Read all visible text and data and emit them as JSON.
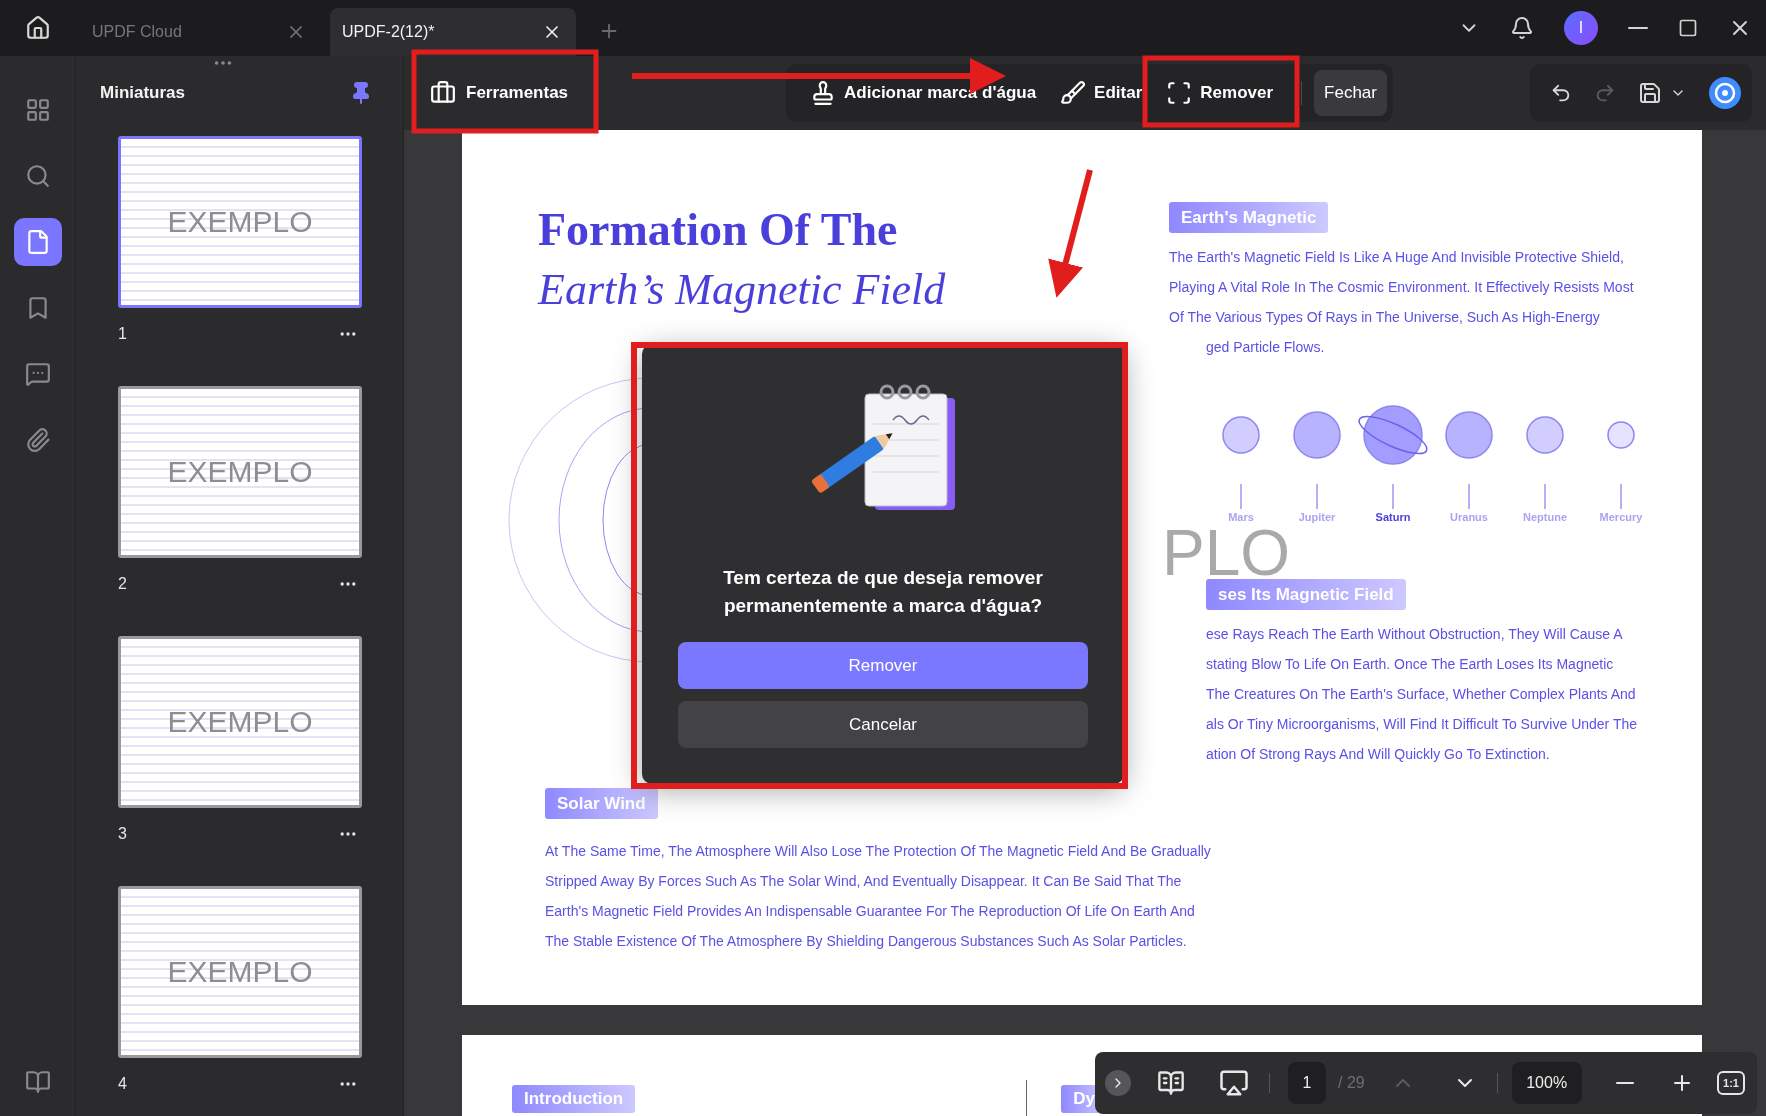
{
  "tabs": [
    {
      "label": "UPDF Cloud",
      "selected": false
    },
    {
      "label": "UPDF-2(12)*",
      "selected": true
    }
  ],
  "account": {
    "initial": "I"
  },
  "rail": [
    {
      "kind": "grid",
      "selected": false
    },
    {
      "kind": "search",
      "selected": false
    },
    {
      "kind": "page",
      "selected": true
    },
    {
      "kind": "bookmark",
      "selected": false
    },
    {
      "kind": "comment",
      "selected": false
    },
    {
      "kind": "attachment",
      "selected": false
    },
    {
      "kind": "library",
      "selected": false
    }
  ],
  "thumbnails": {
    "title": "Miniaturas",
    "pages": [
      {
        "number": "1",
        "watermark": "EXEMPLO",
        "selected": true
      },
      {
        "number": "2",
        "watermark": "EXEMPLO",
        "selected": false
      },
      {
        "number": "3",
        "watermark": "EXEMPLO",
        "selected": false
      },
      {
        "number": "4",
        "watermark": "EXEMPLO",
        "selected": false
      }
    ]
  },
  "toolbar": {
    "tools": "Ferramentas",
    "actions": [
      {
        "label": "Adicionar marca d'água",
        "kind": "add"
      },
      {
        "label": "Editar",
        "kind": "edit"
      },
      {
        "label": "Remover",
        "kind": "remove"
      },
      {
        "label": "Fechar",
        "kind": "close"
      }
    ]
  },
  "document": {
    "title": "Formation Of The",
    "subtitle": "Earth’s Magnetic Field",
    "watermark": "PLO",
    "sections": [
      {
        "heading": {
          "text": "Earth's Magnetic",
          "kind": "open"
        },
        "lines": [
          {
            "text": "The Earth's Magnetic Field Is Like A Huge And Invisible Protective Shield,",
            "kind": "open"
          },
          {
            "text": "Playing A Vital Role In The Cosmic Environment. It Effectively Resists Most",
            "kind": "open"
          },
          {
            "text": "Of The Various Types Of Rays in The Universe, Such As High-Energy",
            "kind": "open"
          },
          {
            "text": "ged Particle Flows.",
            "kind": "behind_dialog"
          }
        ]
      },
      {
        "heading": {
          "text": "ses Its Magnetic Field",
          "kind": "behind_dialog"
        },
        "lines": [
          {
            "text": "ese Rays Reach The Earth Without Obstruction, They Will Cause A",
            "kind": "behind_dialog"
          },
          {
            "text": "stating Blow To Life On Earth. Once The Earth Loses Its Magnetic",
            "kind": "behind_dialog"
          },
          {
            "text": "The Creatures On The Earth's Surface, Whether Complex Plants And",
            "kind": "behind_dialog"
          },
          {
            "text": "als Or Tiny Microorganisms, Will Find It Difficult To Survive Under The",
            "kind": "behind_dialog"
          },
          {
            "text": "ation Of Strong Rays And Will Quickly Go To Extinction.",
            "kind": "behind_dialog"
          }
        ]
      }
    ],
    "planets": [
      {
        "name": "Mars",
        "kind": "plain"
      },
      {
        "name": "Jupiter",
        "kind": "plain"
      },
      {
        "name": "Saturn",
        "kind": "ringed"
      },
      {
        "name": "Uranus",
        "kind": "plain"
      },
      {
        "name": "Neptune",
        "kind": "plain"
      },
      {
        "name": "Mercury",
        "kind": "plain"
      }
    ],
    "solar_wind": {
      "heading": "Solar Wind",
      "lines": [
        "At The Same Time, The Atmosphere Will Also Lose The Protection Of The Magnetic Field And Be Gradually",
        "Stripped Away By Forces Such As The Solar Wind, And Eventually Disappear. It Can Be Said That The",
        "Earth's Magnetic Field Provides An Indispensable Guarantee For The Reproduction Of Life On Earth And",
        "The Stable Existence Of The Atmosphere By Shielding Dangerous Substances Such As Solar Particles."
      ]
    },
    "next_page": {
      "headings": [
        "Introduction",
        "Dy"
      ]
    }
  },
  "dialog": {
    "message": "Tem certeza de que deseja remover permanentemente a marca d'água?",
    "confirm": "Remover",
    "cancel": "Cancelar"
  },
  "page_bar": {
    "page": "1",
    "total": "/ 29",
    "zoom": "100%",
    "actual_size": "1:1"
  }
}
